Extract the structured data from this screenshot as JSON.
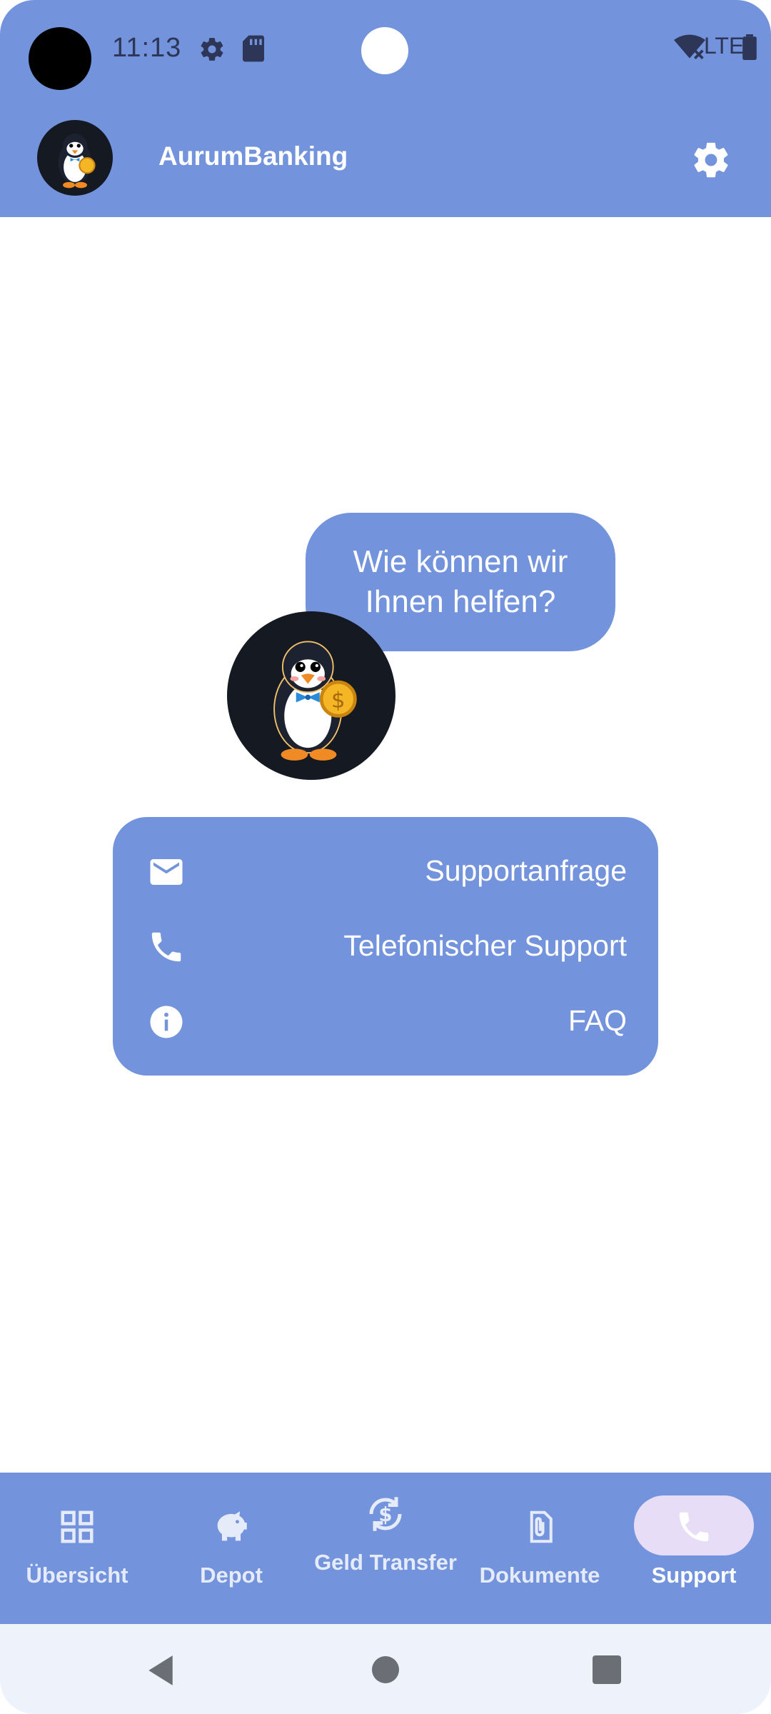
{
  "status_bar": {
    "time": "11:13",
    "network": "LTE"
  },
  "app_bar": {
    "title": "AurumBanking"
  },
  "chat": {
    "message": "Wie können wir Ihnen helfen?"
  },
  "support_menu": {
    "items": [
      {
        "label": "Supportanfrage",
        "icon": "mail-icon"
      },
      {
        "label": "Telefonischer Support",
        "icon": "phone-icon"
      },
      {
        "label": "FAQ",
        "icon": "info-icon"
      }
    ]
  },
  "bottom_nav": {
    "items": [
      {
        "label": "Übersicht",
        "icon": "grid-icon"
      },
      {
        "label": "Depot",
        "icon": "piggy-bank-icon"
      },
      {
        "label": "Geld Transfer",
        "icon": "currency-exchange-icon"
      },
      {
        "label": "Dokumente",
        "icon": "attachment-icon"
      },
      {
        "label": "Support",
        "icon": "phone-icon",
        "selected": true
      }
    ]
  },
  "colors": {
    "primary": "#7393dc",
    "on_primary": "#ffffff",
    "selected_pill": "#e7ddf7",
    "mascot_bg": "#141922"
  }
}
